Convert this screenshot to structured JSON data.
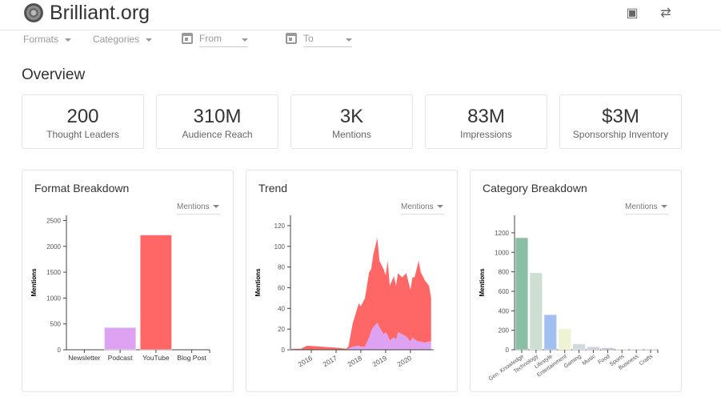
{
  "header": {
    "title": "Brilliant.org",
    "icons": [
      "photo-library-icon",
      "shuffle-icon"
    ]
  },
  "filters": {
    "formats": "Formats",
    "categories": "Categories",
    "from": "From",
    "to": "To"
  },
  "overview": {
    "title": "Overview",
    "stats": [
      {
        "value": "200",
        "label": "Thought Leaders"
      },
      {
        "value": "310M",
        "label": "Audience Reach"
      },
      {
        "value": "3K",
        "label": "Mentions"
      },
      {
        "value": "83M",
        "label": "Impressions"
      },
      {
        "value": "$3M",
        "label": "Sponsorship Inventory"
      }
    ]
  },
  "chart_data": [
    {
      "id": "format",
      "type": "bar",
      "title": "Format Breakdown",
      "metric": "Mentions",
      "ylabel": "Mentions",
      "ylim": [
        0,
        2600
      ],
      "yticks": [
        0,
        500,
        1000,
        1500,
        2000,
        2500
      ],
      "categories": [
        "Newsletter",
        "Podcast",
        "YouTube",
        "Blog Post"
      ],
      "values": [
        0,
        430,
        2220,
        0
      ],
      "colors": [
        "#8bbfa5",
        "#dda3f2",
        "#ff6666",
        "#a3bff0"
      ]
    },
    {
      "id": "trend",
      "type": "area",
      "stacked": true,
      "title": "Trend",
      "metric": "Mentions",
      "ylabel": "Mentions",
      "ylim": [
        0,
        130
      ],
      "yticks": [
        0,
        20,
        40,
        60,
        80,
        100,
        120
      ],
      "xticks": [
        "2016",
        "2017",
        "2018",
        "2019",
        "2020"
      ],
      "series": [
        {
          "color": "#dda3f2",
          "points": [
            [
              "2015-02",
              1
            ],
            [
              "2015-08",
              0
            ],
            [
              "2015-11",
              0
            ],
            [
              "2017-01",
              0
            ],
            [
              "2017-06",
              0
            ],
            [
              "2017-07",
              1
            ],
            [
              "2017-09",
              3
            ],
            [
              "2017-12",
              4
            ],
            [
              "2018-01",
              3
            ],
            [
              "2018-03",
              3
            ],
            [
              "2018-05",
              12
            ],
            [
              "2018-06",
              18
            ],
            [
              "2018-07",
              22
            ],
            [
              "2018-09",
              26
            ],
            [
              "2018-10",
              22
            ],
            [
              "2018-12",
              15
            ],
            [
              "2019-01",
              17
            ],
            [
              "2019-02",
              14
            ],
            [
              "2019-03",
              9
            ],
            [
              "2019-05",
              12
            ],
            [
              "2019-06",
              10
            ],
            [
              "2019-07",
              17
            ],
            [
              "2019-09",
              15
            ],
            [
              "2019-11",
              13
            ],
            [
              "2020-01",
              8
            ],
            [
              "2020-02",
              12
            ],
            [
              "2020-03",
              10
            ],
            [
              "2020-05",
              8
            ],
            [
              "2020-06",
              8
            ],
            [
              "2020-08",
              7
            ],
            [
              "2020-10",
              8
            ],
            [
              "2020-11",
              8
            ]
          ]
        },
        {
          "color": "#ff6666",
          "points": [
            [
              "2015-02",
              0
            ],
            [
              "2015-08",
              1
            ],
            [
              "2015-11",
              4
            ],
            [
              "2017-01",
              2
            ],
            [
              "2017-06",
              1
            ],
            [
              "2017-07",
              2
            ],
            [
              "2017-09",
              22
            ],
            [
              "2017-12",
              41
            ],
            [
              "2018-01",
              39
            ],
            [
              "2018-03",
              47
            ],
            [
              "2018-05",
              63
            ],
            [
              "2018-06",
              60
            ],
            [
              "2018-07",
              70
            ],
            [
              "2018-09",
              82
            ],
            [
              "2018-10",
              64
            ],
            [
              "2018-12",
              63
            ],
            [
              "2019-01",
              55
            ],
            [
              "2019-02",
              72
            ],
            [
              "2019-03",
              53
            ],
            [
              "2019-05",
              59
            ],
            [
              "2019-06",
              52
            ],
            [
              "2019-07",
              57
            ],
            [
              "2019-09",
              55
            ],
            [
              "2019-11",
              61
            ],
            [
              "2020-01",
              50
            ],
            [
              "2020-02",
              58
            ],
            [
              "2020-03",
              60
            ],
            [
              "2020-05",
              78
            ],
            [
              "2020-06",
              67
            ],
            [
              "2020-08",
              60
            ],
            [
              "2020-10",
              54
            ],
            [
              "2020-11",
              42
            ]
          ]
        }
      ]
    },
    {
      "id": "category",
      "type": "bar",
      "title": "Category Breakdown",
      "metric": "Mentions",
      "ylabel": "Mentions",
      "ylim": [
        0,
        1380
      ],
      "yticks": [
        0,
        200,
        400,
        600,
        800,
        1000,
        1200
      ],
      "categories": [
        "Gen. Knowledge",
        "Technology",
        "Lifestyle",
        "Entertainment",
        "Gaming",
        "Music",
        "Food",
        "Sports",
        "Business",
        "Crafts"
      ],
      "values": [
        1150,
        790,
        360,
        215,
        60,
        30,
        18,
        10,
        3,
        3
      ],
      "colors": [
        "#8bbfa5",
        "#cddfd3",
        "#a3bff0",
        "#eef3d3",
        "#d0d8e0",
        "#cfcbe0",
        "#aabbd0",
        "#e3e3c3",
        "#d9d9d9",
        "#f0a0b0"
      ],
      "rotate_labels": true
    }
  ]
}
